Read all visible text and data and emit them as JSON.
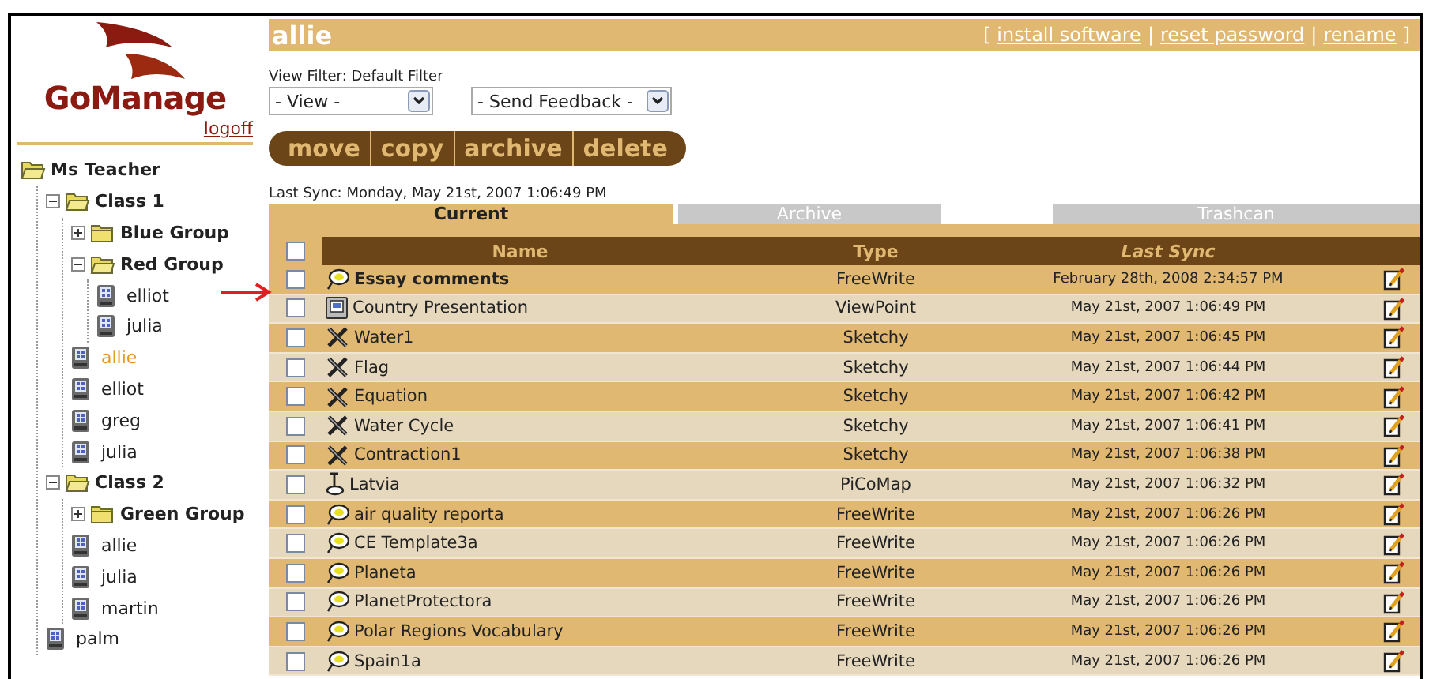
{
  "logo": {
    "text": "GoManage"
  },
  "logoff": "logoff",
  "tree": [
    {
      "kind": "root",
      "label": "Ms Teacher",
      "children": [
        {
          "kind": "folder",
          "label": "Class 1",
          "expanded": true,
          "children": [
            {
              "kind": "folder",
              "label": "Blue Group",
              "expanded": false
            },
            {
              "kind": "folder",
              "label": "Red Group",
              "expanded": true,
              "children": [
                {
                  "kind": "device",
                  "label": "elliot",
                  "selected": false
                },
                {
                  "kind": "device",
                  "label": "julia",
                  "selected": false
                }
              ]
            },
            {
              "kind": "device",
              "label": "allie",
              "selected": true
            },
            {
              "kind": "device",
              "label": "elliot",
              "selected": false
            },
            {
              "kind": "device",
              "label": "greg",
              "selected": false
            },
            {
              "kind": "device",
              "label": "julia",
              "selected": false
            }
          ]
        },
        {
          "kind": "folder",
          "label": "Class 2",
          "expanded": true,
          "children": [
            {
              "kind": "folder",
              "label": "Green Group",
              "expanded": false
            },
            {
              "kind": "device",
              "label": "allie",
              "selected": false
            },
            {
              "kind": "device",
              "label": "julia",
              "selected": false
            },
            {
              "kind": "device",
              "label": "martin",
              "selected": false
            }
          ]
        },
        {
          "kind": "device",
          "label": "palm",
          "selected": false
        }
      ]
    }
  ],
  "header": {
    "title": "allie",
    "open": "[",
    "separator": "|",
    "close": "]",
    "links": [
      "install software",
      "reset password",
      "rename"
    ]
  },
  "filter_label": "View Filter: Default Filter",
  "selects": [
    {
      "value": "- View -"
    },
    {
      "value": "- Send Feedback -"
    }
  ],
  "actions": [
    "move",
    "copy",
    "archive",
    "delete"
  ],
  "last_sync": "Last Sync: Monday, May 21st, 2007 1:06:49 PM",
  "tabs": [
    {
      "label": "Current",
      "selected": true
    },
    {
      "label": "Archive",
      "selected": false
    },
    {
      "label": "Trashcan",
      "selected": false
    }
  ],
  "table": {
    "select_all_checked": false,
    "columns": [
      {
        "label": "Name",
        "sorted": false
      },
      {
        "label": "Type",
        "sorted": false
      },
      {
        "label": "Last Sync",
        "sorted": true
      }
    ],
    "rows": [
      {
        "kind": "freewrite",
        "name": "Essay comments",
        "type": "FreeWrite",
        "last_sync": "February 28th, 2008 2:34:57 PM",
        "unread": true,
        "checked": false
      },
      {
        "kind": "viewpoint",
        "name": "Country Presentation",
        "type": "ViewPoint",
        "last_sync": "May 21st, 2007 1:06:49 PM",
        "unread": false,
        "checked": false
      },
      {
        "kind": "sketchy",
        "name": "Water1",
        "type": "Sketchy",
        "last_sync": "May 21st, 2007 1:06:45 PM",
        "unread": false,
        "checked": false
      },
      {
        "kind": "sketchy",
        "name": "Flag",
        "type": "Sketchy",
        "last_sync": "May 21st, 2007 1:06:44 PM",
        "unread": false,
        "checked": false
      },
      {
        "kind": "sketchy",
        "name": "Equation",
        "type": "Sketchy",
        "last_sync": "May 21st, 2007 1:06:42 PM",
        "unread": false,
        "checked": false
      },
      {
        "kind": "sketchy",
        "name": "Water Cycle",
        "type": "Sketchy",
        "last_sync": "May 21st, 2007 1:06:41 PM",
        "unread": false,
        "checked": false
      },
      {
        "kind": "sketchy",
        "name": "Contraction1",
        "type": "Sketchy",
        "last_sync": "May 21st, 2007 1:06:38 PM",
        "unread": false,
        "checked": false
      },
      {
        "kind": "picomap",
        "name": "Latvia",
        "type": "PiCoMap",
        "last_sync": "May 21st, 2007 1:06:32 PM",
        "unread": false,
        "checked": false
      },
      {
        "kind": "freewrite",
        "name": "air quality reporta",
        "type": "FreeWrite",
        "last_sync": "May 21st, 2007 1:06:26 PM",
        "unread": false,
        "checked": false
      },
      {
        "kind": "freewrite",
        "name": "CE Template3a",
        "type": "FreeWrite",
        "last_sync": "May 21st, 2007 1:06:26 PM",
        "unread": false,
        "checked": false
      },
      {
        "kind": "freewrite",
        "name": "Planeta",
        "type": "FreeWrite",
        "last_sync": "May 21st, 2007 1:06:26 PM",
        "unread": false,
        "checked": false
      },
      {
        "kind": "freewrite",
        "name": "PlanetProtectora",
        "type": "FreeWrite",
        "last_sync": "May 21st, 2007 1:06:26 PM",
        "unread": false,
        "checked": false
      },
      {
        "kind": "freewrite",
        "name": "Polar Regions Vocabulary",
        "type": "FreeWrite",
        "last_sync": "May 21st, 2007 1:06:26 PM",
        "unread": false,
        "checked": false
      },
      {
        "kind": "freewrite",
        "name": "Spain1a",
        "type": "FreeWrite",
        "last_sync": "May 21st, 2007 1:06:26 PM",
        "unread": false,
        "checked": false
      }
    ]
  }
}
